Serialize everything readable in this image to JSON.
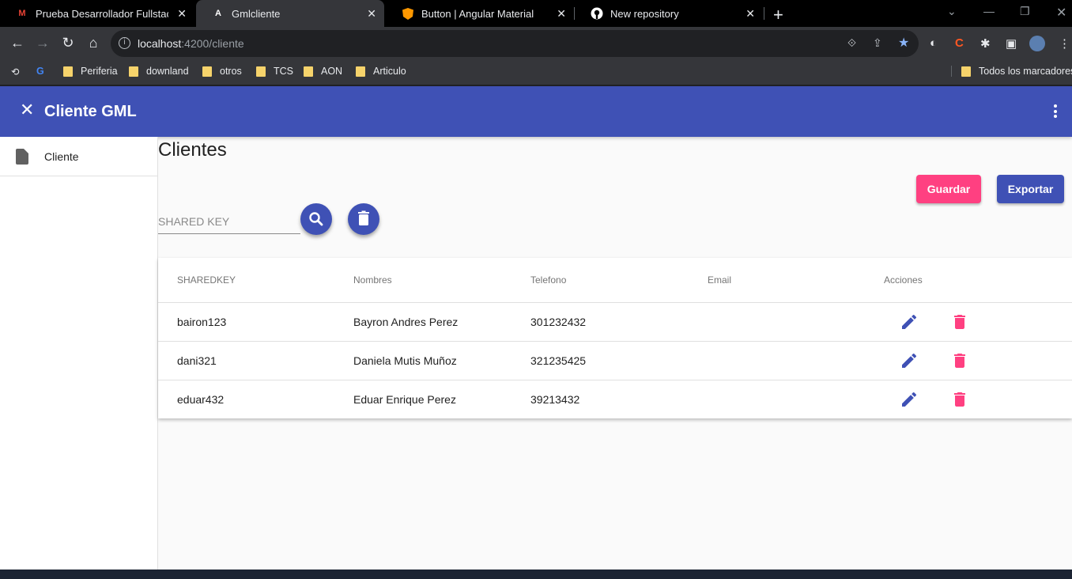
{
  "browser": {
    "tabs": [
      {
        "title": "Prueba Desarrollador Fullstack -",
        "icon": "gmail-icon",
        "close": "✕"
      },
      {
        "title": "Gmlcliente",
        "icon": "angular-icon",
        "close": "✕"
      },
      {
        "title": "Button | Angular Material",
        "icon": "angular-material-icon",
        "close": "✕"
      },
      {
        "title": "New repository",
        "icon": "github-icon",
        "close": "✕"
      }
    ],
    "url_host": "localhost",
    "url_path": ":4200/cliente",
    "bookmarks": [
      "Periferia",
      "downland",
      "otros",
      "TCS",
      "AON",
      "Articulo"
    ],
    "bookmarks_right": "Todos los marcadores"
  },
  "app": {
    "title": "Cliente GML",
    "sidenav": {
      "items": [
        {
          "label": "Cliente",
          "icon": "document-icon"
        }
      ]
    },
    "page_title": "Clientes",
    "buttons": {
      "save": "Guardar",
      "export": "Exportar"
    },
    "search": {
      "placeholder": "SHARED KEY",
      "value": ""
    },
    "table": {
      "headers": [
        "SHAREDKEY",
        "Nombres",
        "Telefono",
        "Email",
        "Acciones"
      ],
      "rows": [
        {
          "sharedkey": "bairon123",
          "nombres": "Bayron Andres Perez",
          "telefono": "301232432",
          "email": ""
        },
        {
          "sharedkey": "dani321",
          "nombres": "Daniela Mutis Muñoz",
          "telefono": "321235425",
          "email": ""
        },
        {
          "sharedkey": "eduar432",
          "nombres": "Eduar Enrique Perez",
          "telefono": "39213432",
          "email": ""
        }
      ]
    },
    "colors": {
      "primary": "#3f51b5",
      "accent": "#ff4081"
    }
  }
}
